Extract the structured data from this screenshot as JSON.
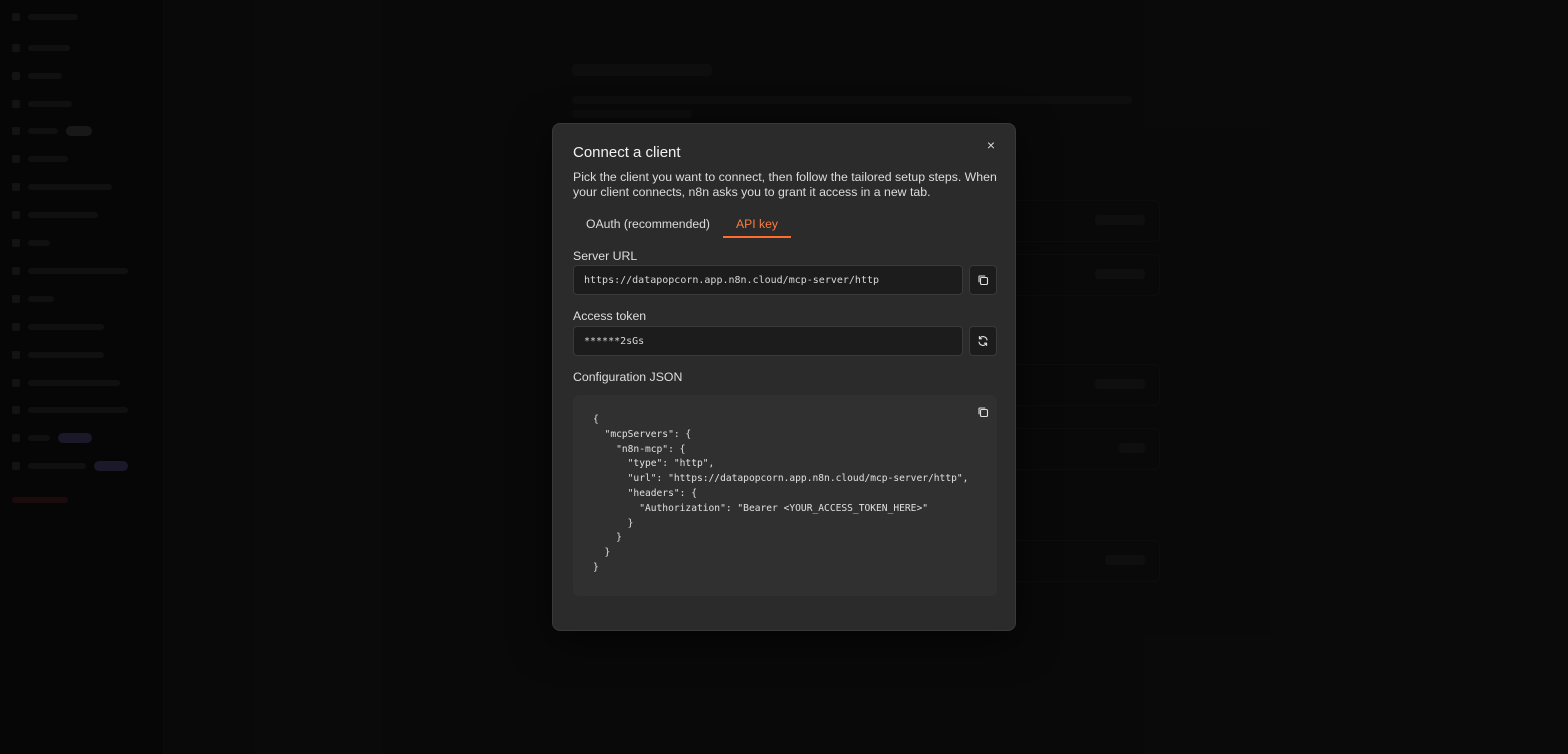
{
  "modal": {
    "title": "Connect a client",
    "description": "Pick the client you want to connect, then follow the tailored setup steps. When your client connects, n8n asks you to grant it access in a new tab.",
    "close_glyph": "×",
    "tabs": [
      {
        "label": "OAuth (recommended)",
        "active": false
      },
      {
        "label": "API key",
        "active": true
      }
    ],
    "server_url": {
      "label": "Server URL",
      "value": "https://datapopcorn.app.n8n.cloud/mcp-server/http"
    },
    "access_token": {
      "label": "Access token",
      "value": "******2sGs"
    },
    "config_json": {
      "label": "Configuration JSON",
      "lines": [
        "{",
        "  \"mcpServers\": {",
        "    \"n8n-mcp\": {",
        "      \"type\": \"http\",",
        "      \"url\": \"https://datapopcorn.app.n8n.cloud/mcp-server/http\",",
        "      \"headers\": {",
        "        \"Authorization\": \"Bearer <YOUR_ACCESS_TOKEN_HERE>\"",
        "      }",
        "    }",
        "  }",
        "}"
      ]
    }
  },
  "colors": {
    "accent": "#ff6d2d",
    "modal_bg": "#2b2b2b",
    "input_bg": "#1c1c1c",
    "code_bg": "#303030"
  },
  "icons": {
    "close": "close-icon",
    "copy": "copy-icon",
    "refresh": "refresh-icon"
  }
}
